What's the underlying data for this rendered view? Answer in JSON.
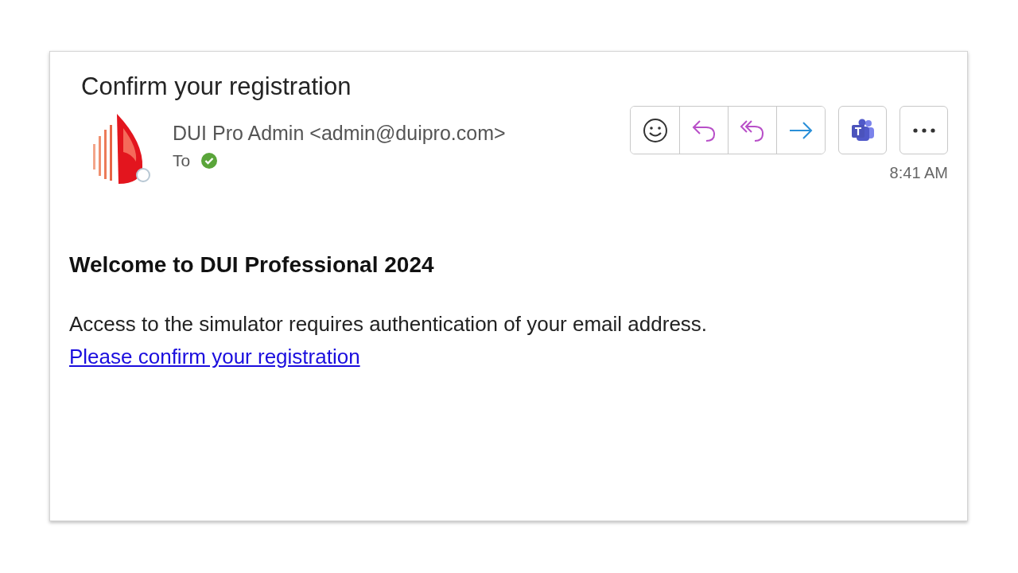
{
  "subject": "Confirm your registration",
  "sender": {
    "name": "DUI Pro Admin <admin@duipro.com>",
    "to_label": "To",
    "verified": true
  },
  "actions": [
    {
      "kind": "emoji"
    },
    {
      "kind": "reply"
    },
    {
      "kind": "reply-all"
    },
    {
      "kind": "forward"
    }
  ],
  "time": "8:41 AM",
  "body": {
    "heading": "Welcome to DUI Professional 2024",
    "text": "Access to the simulator requires authentication of your email address.",
    "link": "Please confirm your registration"
  }
}
